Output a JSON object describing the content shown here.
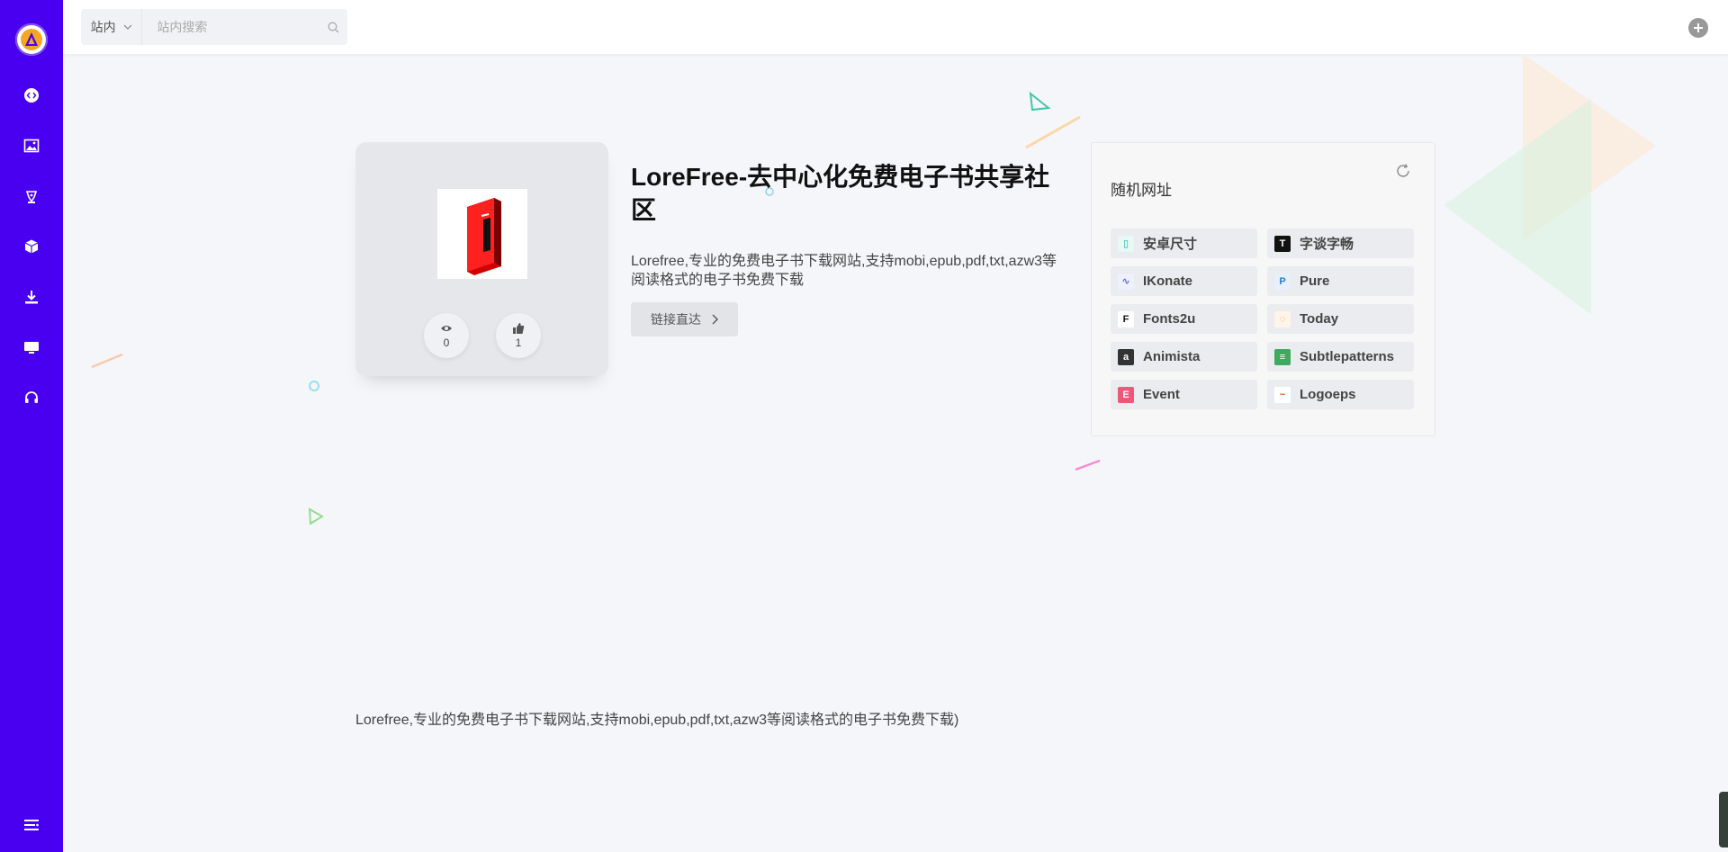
{
  "colors": {
    "sidebar": "#4a00f0",
    "background": "#f5f6fa",
    "card": "#e6e7eb"
  },
  "sidebar": {
    "items": [
      {
        "icon": "code-icon"
      },
      {
        "icon": "image-icon"
      },
      {
        "icon": "pen-icon"
      },
      {
        "icon": "cube-icon"
      },
      {
        "icon": "download-icon"
      },
      {
        "icon": "monitor-icon"
      },
      {
        "icon": "headphones-icon"
      }
    ],
    "bottom_icon": "menu-icon"
  },
  "header": {
    "scope_label": "站内",
    "search_placeholder": "站内搜索"
  },
  "site": {
    "title": "LoreFree-去中心化免费电子书共享社区",
    "description": "Lorefree,专业的免费电子书下载网站,支持mobi,epub,pdf,txt,azw3等阅读格式的电子书免费下载",
    "views": "0",
    "likes": "1",
    "goto_label": "链接直达"
  },
  "random": {
    "title": "随机网址",
    "items": [
      {
        "name": "安卓尺寸",
        "icon_color": "#e8f8f5",
        "icon_text": "▯",
        "icon_fg": "#1abc9c"
      },
      {
        "name": "字谈字畅",
        "icon_color": "#111111",
        "icon_text": "T",
        "icon_fg": "#ffffff"
      },
      {
        "name": "IKonate",
        "icon_color": "#eef0ff",
        "icon_text": "∿",
        "icon_fg": "#5b6bd6"
      },
      {
        "name": "Pure",
        "icon_color": "#e7f0fb",
        "icon_text": "P",
        "icon_fg": "#2d7dd2"
      },
      {
        "name": "Fonts2u",
        "icon_color": "#ffffff",
        "icon_text": "F",
        "icon_fg": "#111111"
      },
      {
        "name": "Today",
        "icon_color": "#fff4ea",
        "icon_text": "◌",
        "icon_fg": "#f39c4a"
      },
      {
        "name": "Animista",
        "icon_color": "#333333",
        "icon_text": "a",
        "icon_fg": "#ffffff"
      },
      {
        "name": "Subtlepatterns",
        "icon_color": "#3eaa5e",
        "icon_text": "≡",
        "icon_fg": "#ffffff"
      },
      {
        "name": "Event",
        "icon_color": "#f0557a",
        "icon_text": "E",
        "icon_fg": "#ffffff"
      },
      {
        "name": "Logoeps",
        "icon_color": "#ffffff",
        "icon_text": "~",
        "icon_fg": "#e55a2b"
      }
    ]
  },
  "footer": {
    "description": "Lorefree,专业的免费电子书下载网站,支持mobi,epub,pdf,txt,azw3等阅读格式的电子书免费下载)"
  }
}
